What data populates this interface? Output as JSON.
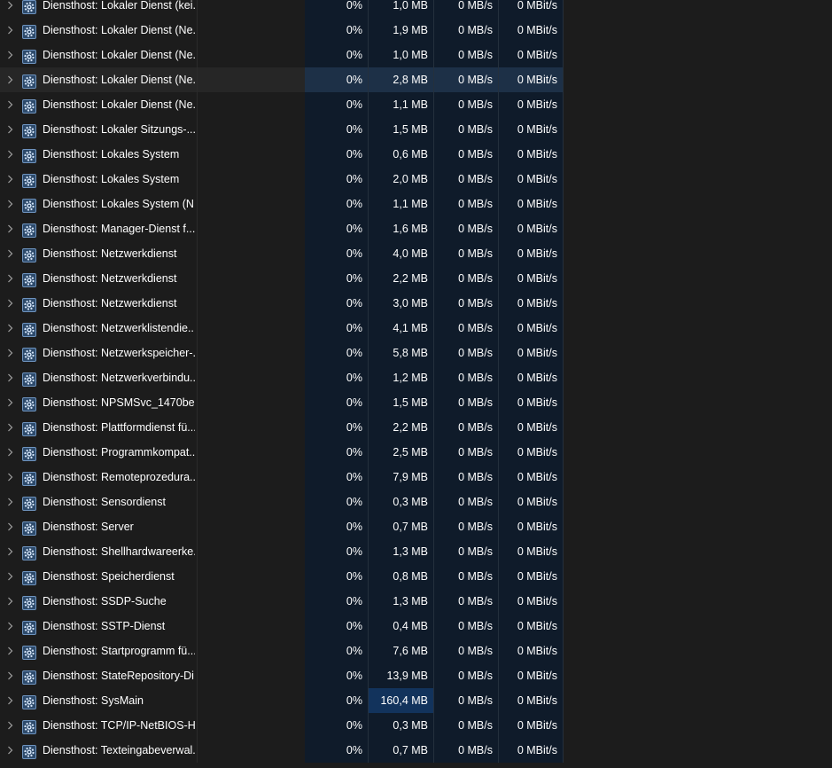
{
  "process_list": {
    "rows": [
      {
        "name": "Diensthost: Lokaler Dienst (kei...",
        "cpu": "0%",
        "memory": "1,0 MB",
        "disk": "0 MB/s",
        "network": "0 MBit/s"
      },
      {
        "name": "Diensthost: Lokaler Dienst (Ne...",
        "cpu": "0%",
        "memory": "1,9 MB",
        "disk": "0 MB/s",
        "network": "0 MBit/s"
      },
      {
        "name": "Diensthost: Lokaler Dienst (Ne...",
        "cpu": "0%",
        "memory": "1,0 MB",
        "disk": "0 MB/s",
        "network": "0 MBit/s"
      },
      {
        "name": "Diensthost: Lokaler Dienst (Ne...",
        "cpu": "0%",
        "memory": "2,8 MB",
        "disk": "0 MB/s",
        "network": "0 MBit/s",
        "hover": true
      },
      {
        "name": "Diensthost: Lokaler Dienst (Ne...",
        "cpu": "0%",
        "memory": "1,1 MB",
        "disk": "0 MB/s",
        "network": "0 MBit/s"
      },
      {
        "name": "Diensthost: Lokaler Sitzungs-...",
        "cpu": "0%",
        "memory": "1,5 MB",
        "disk": "0 MB/s",
        "network": "0 MBit/s"
      },
      {
        "name": "Diensthost: Lokales System",
        "cpu": "0%",
        "memory": "0,6 MB",
        "disk": "0 MB/s",
        "network": "0 MBit/s"
      },
      {
        "name": "Diensthost: Lokales System",
        "cpu": "0%",
        "memory": "2,0 MB",
        "disk": "0 MB/s",
        "network": "0 MBit/s"
      },
      {
        "name": "Diensthost: Lokales System (N...",
        "cpu": "0%",
        "memory": "1,1 MB",
        "disk": "0 MB/s",
        "network": "0 MBit/s"
      },
      {
        "name": "Diensthost: Manager-Dienst f...",
        "cpu": "0%",
        "memory": "1,6 MB",
        "disk": "0 MB/s",
        "network": "0 MBit/s"
      },
      {
        "name": "Diensthost: Netzwerkdienst",
        "cpu": "0%",
        "memory": "4,0 MB",
        "disk": "0 MB/s",
        "network": "0 MBit/s"
      },
      {
        "name": "Diensthost: Netzwerkdienst",
        "cpu": "0%",
        "memory": "2,2 MB",
        "disk": "0 MB/s",
        "network": "0 MBit/s"
      },
      {
        "name": "Diensthost: Netzwerkdienst",
        "cpu": "0%",
        "memory": "3,0 MB",
        "disk": "0 MB/s",
        "network": "0 MBit/s"
      },
      {
        "name": "Diensthost: Netzwerklistendie...",
        "cpu": "0%",
        "memory": "4,1 MB",
        "disk": "0 MB/s",
        "network": "0 MBit/s"
      },
      {
        "name": "Diensthost: Netzwerkspeicher-...",
        "cpu": "0%",
        "memory": "5,8 MB",
        "disk": "0 MB/s",
        "network": "0 MBit/s"
      },
      {
        "name": "Diensthost: Netzwerkverbindu...",
        "cpu": "0%",
        "memory": "1,2 MB",
        "disk": "0 MB/s",
        "network": "0 MBit/s"
      },
      {
        "name": "Diensthost: NPSMSvc_1470be",
        "cpu": "0%",
        "memory": "1,5 MB",
        "disk": "0 MB/s",
        "network": "0 MBit/s"
      },
      {
        "name": "Diensthost: Plattformdienst fü...",
        "cpu": "0%",
        "memory": "2,2 MB",
        "disk": "0 MB/s",
        "network": "0 MBit/s"
      },
      {
        "name": "Diensthost: Programmkompat...",
        "cpu": "0%",
        "memory": "2,5 MB",
        "disk": "0 MB/s",
        "network": "0 MBit/s"
      },
      {
        "name": "Diensthost: Remoteprozedura...",
        "cpu": "0%",
        "memory": "7,9 MB",
        "disk": "0 MB/s",
        "network": "0 MBit/s"
      },
      {
        "name": "Diensthost: Sensordienst",
        "cpu": "0%",
        "memory": "0,3 MB",
        "disk": "0 MB/s",
        "network": "0 MBit/s"
      },
      {
        "name": "Diensthost: Server",
        "cpu": "0%",
        "memory": "0,7 MB",
        "disk": "0 MB/s",
        "network": "0 MBit/s"
      },
      {
        "name": "Diensthost: Shellhardwareerke...",
        "cpu": "0%",
        "memory": "1,3 MB",
        "disk": "0 MB/s",
        "network": "0 MBit/s"
      },
      {
        "name": "Diensthost: Speicherdienst",
        "cpu": "0%",
        "memory": "0,8 MB",
        "disk": "0 MB/s",
        "network": "0 MBit/s"
      },
      {
        "name": "Diensthost: SSDP-Suche",
        "cpu": "0%",
        "memory": "1,3 MB",
        "disk": "0 MB/s",
        "network": "0 MBit/s"
      },
      {
        "name": "Diensthost: SSTP-Dienst",
        "cpu": "0%",
        "memory": "0,4 MB",
        "disk": "0 MB/s",
        "network": "0 MBit/s"
      },
      {
        "name": "Diensthost: Startprogramm fü...",
        "cpu": "0%",
        "memory": "7,6 MB",
        "disk": "0 MB/s",
        "network": "0 MBit/s"
      },
      {
        "name": "Diensthost: StateRepository-Di...",
        "cpu": "0%",
        "memory": "13,9 MB",
        "disk": "0 MB/s",
        "network": "0 MBit/s"
      },
      {
        "name": "Diensthost: SysMain",
        "cpu": "0%",
        "memory": "160,4 MB",
        "disk": "0 MB/s",
        "network": "0 MBit/s",
        "memory_high": true
      },
      {
        "name": "Diensthost: TCP/IP-NetBIOS-H...",
        "cpu": "0%",
        "memory": "0,3 MB",
        "disk": "0 MB/s",
        "network": "0 MBit/s"
      },
      {
        "name": "Diensthost: Texteingabeverwal...",
        "cpu": "0%",
        "memory": "0,7 MB",
        "disk": "0 MB/s",
        "network": "0 MBit/s"
      }
    ]
  },
  "icons": {
    "expand": "chevron-right-icon",
    "process": "service-gear-icon"
  },
  "colors": {
    "background": "#1c1c1c",
    "metric_column": "#0f1b2a",
    "memory_high": "#12335c",
    "hover_row": "#262626",
    "icon_gear": "#a8c8ee"
  }
}
